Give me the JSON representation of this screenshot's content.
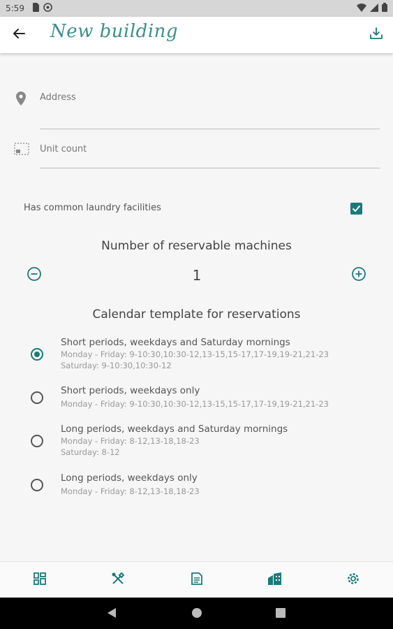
{
  "status_bar": {
    "time": "5:59",
    "left_icons": [
      "sim-card-icon",
      "sync-icon"
    ],
    "right_icons": [
      "wifi-icon",
      "signal-icon",
      "battery-icon"
    ]
  },
  "app_bar": {
    "title": "New building",
    "back_icon": "arrow-left-icon",
    "action_icon": "download-icon"
  },
  "form": {
    "address": {
      "placeholder": "Address",
      "value": "",
      "icon": "location-pin-icon"
    },
    "unit_count": {
      "placeholder": "Unit count",
      "value": "",
      "icon": "units-icon"
    },
    "laundry": {
      "label": "Has common laundry facilities",
      "checked": true
    }
  },
  "machines": {
    "title": "Number of reservable machines",
    "value": "1"
  },
  "calendar": {
    "title": "Calendar template for reservations",
    "options": [
      {
        "title": "Short periods, weekdays and Saturday mornings",
        "lines": [
          "Monday - Friday: 9-10:30,10:30-12,13-15,15-17,17-19,19-21,21-23",
          "Saturday: 9-10:30,10:30-12"
        ],
        "selected": true
      },
      {
        "title": "Short periods, weekdays only",
        "lines": [
          "Monday - Friday: 9-10:30,10:30-12,13-15,15-17,17-19,19-21,21-23"
        ],
        "selected": false
      },
      {
        "title": "Long periods, weekdays and Saturday mornings",
        "lines": [
          "Monday - Friday: 8-12,13-18,18-23",
          "Saturday: 8-12"
        ],
        "selected": false
      },
      {
        "title": "Long periods, weekdays only",
        "lines": [
          "Monday - Friday: 8-12,13-18,18-23"
        ],
        "selected": false
      }
    ]
  },
  "bottom_nav": {
    "items": [
      {
        "icon": "dashboard-icon"
      },
      {
        "icon": "tools-icon"
      },
      {
        "icon": "document-icon"
      },
      {
        "icon": "building-icon",
        "active": true
      },
      {
        "icon": "settings-icon"
      }
    ]
  },
  "system_nav": [
    "back-triangle-icon",
    "home-circle-icon",
    "recents-square-icon"
  ],
  "colors": {
    "accent": "#1a7a7a",
    "title_script": "#3d8f8c",
    "background": "#f6f6f6"
  }
}
